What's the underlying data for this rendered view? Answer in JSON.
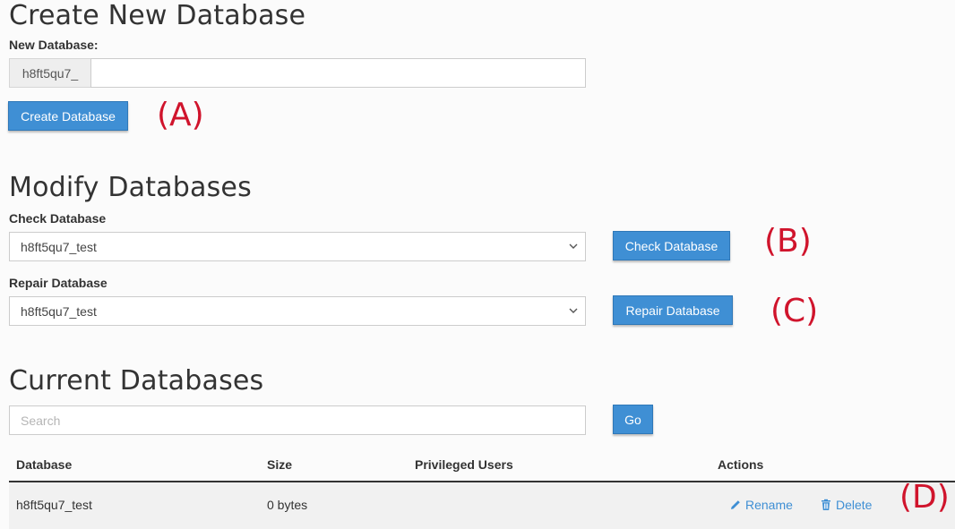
{
  "create": {
    "title": "Create New Database",
    "field_label": "New Database:",
    "prefix": "h8ft5qu7_",
    "value": "",
    "button": "Create Database",
    "annotation": "(A)"
  },
  "modify": {
    "title": "Modify Databases",
    "check_label": "Check Database",
    "check_selected": "h8ft5qu7_test",
    "check_button": "Check Database",
    "check_annotation": "(B)",
    "repair_label": "Repair Database",
    "repair_selected": "h8ft5qu7_test",
    "repair_button": "Repair Database",
    "repair_annotation": "(C)"
  },
  "current": {
    "title": "Current Databases",
    "search_placeholder": "Search",
    "go_button": "Go",
    "columns": [
      "Database",
      "Size",
      "Privileged Users",
      "Actions"
    ],
    "rows": [
      {
        "database": "h8ft5qu7_test",
        "size": "0 bytes",
        "privileged_users": "",
        "rename": "Rename",
        "delete": "Delete"
      }
    ],
    "annotation": "(D)"
  },
  "colors": {
    "primary": "#3f8fd4",
    "annotation": "#d0142c"
  },
  "icons": {
    "rename": "pencil-icon",
    "delete": "trash-icon",
    "select": "chevron-down-icon"
  }
}
